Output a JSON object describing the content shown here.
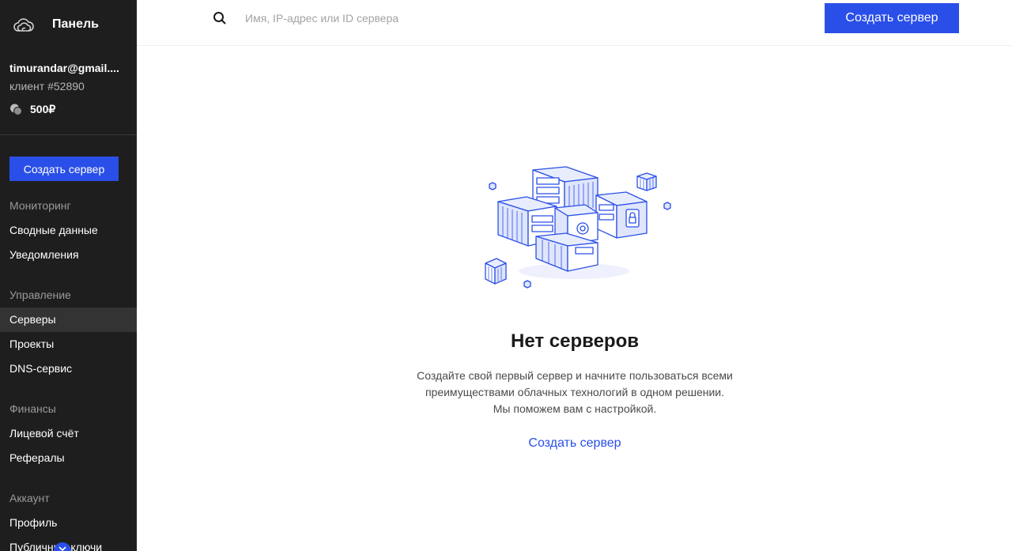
{
  "sidebar": {
    "brand_title": "Панель",
    "account": {
      "email": "timurandar@gmail....",
      "client": "клиент #52890",
      "balance": "500₽"
    },
    "create_button": "Создать сервер",
    "sections": {
      "monitoring": {
        "label": "Мониторинг",
        "items": [
          "Сводные данные",
          "Уведомления"
        ]
      },
      "management": {
        "label": "Управление",
        "items": [
          "Серверы",
          "Проекты",
          "DNS-сервис"
        ]
      },
      "finance": {
        "label": "Финансы",
        "items": [
          "Лицевой счёт",
          "Рефералы"
        ]
      },
      "account": {
        "label": "Аккаунт",
        "items": [
          "Профиль",
          "Публичные ключи"
        ]
      }
    }
  },
  "header": {
    "search_placeholder": "Имя, IP-адрес или ID сервера",
    "create_button": "Создать сервер"
  },
  "empty_state": {
    "title": "Нет серверов",
    "description": "Создайте свой первый сервер и начните пользоваться всеми преимуществами облачных технологий в одном решении. Мы поможем вам с настройкой.",
    "link": "Создать сервер"
  },
  "colors": {
    "sidebar_bg": "#1e1e1e",
    "accent": "#2a4fe8"
  },
  "icons": {
    "logo": "cloud-logo-icon",
    "coin": "coins-icon",
    "search": "search-icon",
    "collapse": "chevron-down-icon"
  }
}
